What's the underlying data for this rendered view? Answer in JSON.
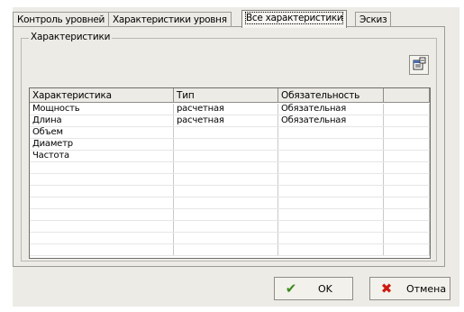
{
  "tabs": [
    {
      "label": "Контроль уровней"
    },
    {
      "label": "Характеристики уровня"
    },
    {
      "label": "Все характеристики"
    },
    {
      "label": "Эскиз"
    }
  ],
  "group": {
    "title": "Характеристики"
  },
  "props_button": {
    "icon": "properties-icon"
  },
  "table": {
    "headers": [
      "Характеристика",
      "Тип",
      "Обязательность",
      ""
    ],
    "rows": [
      [
        "Мощность",
        "расчетная",
        "Обязательная",
        ""
      ],
      [
        "Длина",
        "расчетная",
        "Обязательная",
        ""
      ],
      [
        "Объем",
        "",
        "",
        ""
      ],
      [
        "Диаметр",
        "",
        "",
        ""
      ],
      [
        "Частота",
        "",
        "",
        ""
      ],
      [
        "",
        "",
        "",
        ""
      ],
      [
        "",
        "",
        "",
        ""
      ],
      [
        "",
        "",
        "",
        ""
      ],
      [
        "",
        "",
        "",
        ""
      ],
      [
        "",
        "",
        "",
        ""
      ],
      [
        "",
        "",
        "",
        ""
      ],
      [
        "",
        "",
        "",
        ""
      ],
      [
        "",
        "",
        "",
        ""
      ]
    ]
  },
  "buttons": {
    "ok": {
      "label": "OK",
      "icon": "check-icon"
    },
    "cancel": {
      "label": "Отмена",
      "icon": "x-icon"
    }
  },
  "colors": {
    "check": "#3a8a1a",
    "cancel": "#cc1a10"
  }
}
